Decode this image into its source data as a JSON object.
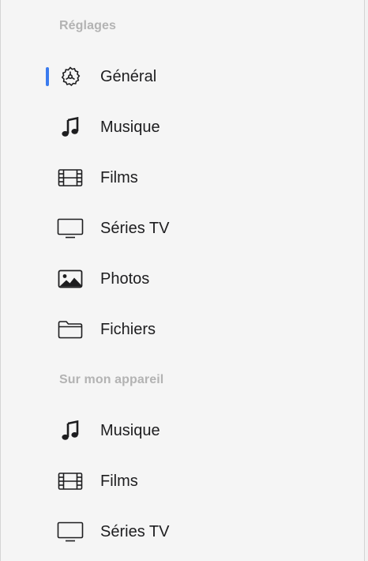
{
  "sidebar": {
    "settings": {
      "header": "Réglages",
      "items": [
        {
          "label": "Général",
          "icon": "gear-icon",
          "selected": true
        },
        {
          "label": "Musique",
          "icon": "music-note-icon",
          "selected": false
        },
        {
          "label": "Films",
          "icon": "film-icon",
          "selected": false
        },
        {
          "label": "Séries TV",
          "icon": "tv-icon",
          "selected": false
        },
        {
          "label": "Photos",
          "icon": "photo-icon",
          "selected": false
        },
        {
          "label": "Fichiers",
          "icon": "folder-icon",
          "selected": false
        }
      ]
    },
    "device": {
      "header": "Sur mon appareil",
      "items": [
        {
          "label": "Musique",
          "icon": "music-note-icon"
        },
        {
          "label": "Films",
          "icon": "film-icon"
        },
        {
          "label": "Séries TV",
          "icon": "tv-icon"
        }
      ]
    }
  },
  "colors": {
    "accent": "#3a7bef",
    "header_text": "#b3b3b3",
    "item_text": "#1d1d1f"
  }
}
